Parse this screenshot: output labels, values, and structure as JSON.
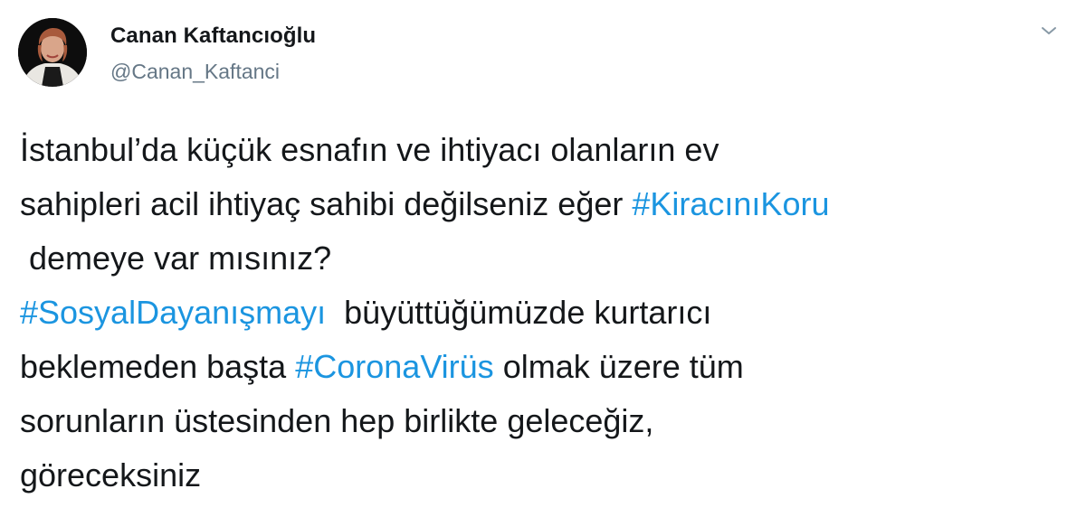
{
  "tweet": {
    "author": {
      "name": "Canan Kaftancıoğlu",
      "handle": "@Canan_Kaftanci"
    },
    "menu_icon": "chevron-down-icon",
    "link_color": "#1b95e0",
    "text_color": "#14171a",
    "muted_color": "#657786",
    "body": {
      "line1": "İstanbul’da küçük esnafın ve ihtiyacı olanların ev",
      "line2_text": "sahipleri acil ihtiyaç sahibi değilseniz eğer ",
      "line2_hashtag": "#KiracınıKoru",
      "line3": " demeye var mısınız?",
      "line4_hashtag": "#SosyalDayanışmayı",
      "line4_text": "  büyüttüğümüzde kurtarıcı",
      "line5_text_a": "beklemeden başta ",
      "line5_hashtag": "#CoronaVirüs",
      "line5_text_b": " olmak üzere tüm",
      "line6": "sorunların üstesinden hep birlikte geleceğiz,",
      "line7": "göreceksiniz"
    }
  }
}
